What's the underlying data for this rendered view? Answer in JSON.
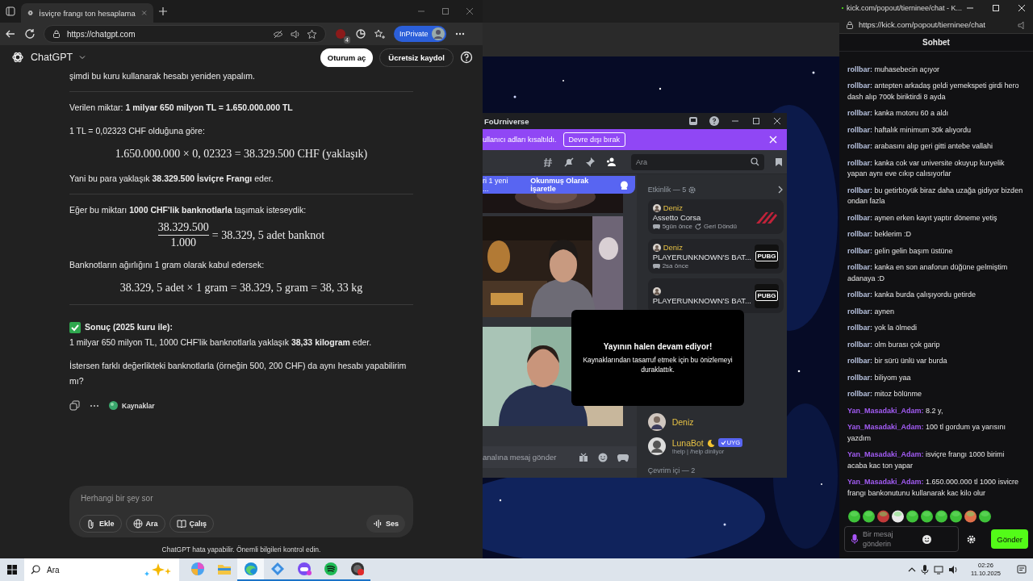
{
  "browser": {
    "tab_title": "İsviçre frangı ton hesaplama",
    "address": "https://chatgpt.com",
    "extension_badge": "4",
    "profile_label": "InPrivate"
  },
  "chatgpt": {
    "brand": "ChatGPT",
    "login_button": "Oturum aç",
    "signup_button": "Ücretsiz kaydol",
    "blocks": [
      {
        "kind": "paragraph",
        "text": "şimdi bu kuru kullanarak hesabı yeniden yapalım."
      },
      {
        "kind": "rule"
      },
      {
        "kind": "paragraph",
        "text": "Verilen miktar: **1 milyar 650 milyon TL = 1.650.000.000 TL**"
      },
      {
        "kind": "paragraph",
        "text": "1 TL = 0,02323 CHF olduğuna göre:"
      },
      {
        "kind": "formula",
        "text": "1.650.000.000 × 0, 02323 = 38.329.500 CHF (yaklaşık)"
      },
      {
        "kind": "paragraph",
        "text": "Yani bu para yaklaşık **38.329.500 İsviçre Frangı** eder."
      },
      {
        "kind": "rule"
      },
      {
        "kind": "paragraph",
        "text": "Eğer bu miktarı **1000 CHF'lik banknotlarla** taşımak isteseydik:"
      },
      {
        "kind": "fraction",
        "numerator": "38.329.500",
        "denominator": "1.000",
        "rest": "= 38.329, 5 adet banknot"
      },
      {
        "kind": "paragraph",
        "text": "Banknotların ağırlığını 1 gram olarak kabul edersek:"
      },
      {
        "kind": "formula",
        "text": "38.329, 5 adet × 1 gram = 38.329, 5 gram = 38, 33 kg"
      },
      {
        "kind": "rule"
      },
      {
        "kind": "heading",
        "text": "Sonuç (2025 kuru ile):"
      },
      {
        "kind": "paragraph",
        "text": "1 milyar 650 milyon TL, 1000 CHF'lik banknotlarla yaklaşık **38,33 kilogram** eder."
      },
      {
        "kind": "paragraph",
        "text": "İstersen farklı değerlikteki banknotlarla (örneğin 500, 200 CHF) da aynı hesabı yapabilirim mı?"
      }
    ],
    "sources_label": "Kaynaklar",
    "composer": {
      "placeholder": "Herhangi bir şey sor",
      "tools": [
        {
          "kind": "attach",
          "label": "Ekle"
        },
        {
          "kind": "search",
          "label": "Ara"
        },
        {
          "kind": "study",
          "label": "Çalış"
        }
      ],
      "voice": "Ses"
    },
    "disclaimer": "ChatGPT hata yapabilir. Önemli bilgileri kontrol edin."
  },
  "discord": {
    "title": "FoUrniverse",
    "banner": {
      "text": "ullanıcı adları kısaltıldı.",
      "button": "Devre dışı bırak"
    },
    "toolbar": [
      {
        "kind": "threads",
        "selected": false
      },
      {
        "kind": "mute",
        "selected": false
      },
      {
        "kind": "pin",
        "selected": false
      },
      {
        "kind": "members",
        "selected": true
      }
    ],
    "search_placeholder": "Ara",
    "unread_bar": {
      "text": "ri 1 yeni ...",
      "action": "Okunmuş Olarak İşaretle"
    },
    "message_placeholder": "analına mesaj gönder",
    "activity": {
      "title": "Etkinlik — 5",
      "cards": [
        {
          "user": "Deniz",
          "game": "Assetto Corsa",
          "time": "5gün önce",
          "status": "Geri Döndü",
          "kind": "assetto"
        },
        {
          "user": "Deniz",
          "game": "PLAYERUNKNOWN'S BAT...",
          "time": "2sa önce",
          "kind": "pubg",
          "art_text": "PUBG"
        },
        {
          "game": "PLAYERUNKNOWN'S BAT...",
          "kind": "pubg",
          "art_text": "PUBG"
        }
      ]
    },
    "notice": {
      "title": "Yayının halen devam ediyor!",
      "text": "Kaynaklarından tasarruf etmek için bu önizlemeyi duraklattık."
    },
    "members": [
      {
        "name": "Deniz",
        "bot": false
      },
      {
        "name": "LunaBot",
        "bot": true,
        "tag": "UYG",
        "status": "!help | /help dinliyor"
      }
    ],
    "online_header": "Çevrim içi — 2"
  },
  "kick": {
    "title": "kick.com/popout/tierninee/chat - K...",
    "address": "https://kick.com/popout/tierninee/chat",
    "header": "Sohbet",
    "messages": [
      {
        "user": "rollbar:",
        "color": "#b7c2de",
        "text": "muhasebecin açıyor"
      },
      {
        "user": "rollbar:",
        "color": "#b7c2de",
        "text": "antepten arkadaş geldi yemekspeti girdi hero dash alıp 700k biriktirdi 8 ayda"
      },
      {
        "user": "rollbar:",
        "color": "#b7c2de",
        "text": "kanka motoru 60 a aldı"
      },
      {
        "user": "rollbar:",
        "color": "#b7c2de",
        "text": "haftalık minimum 30k alıyordu"
      },
      {
        "user": "rollbar:",
        "color": "#b7c2de",
        "text": "arabasını alıp geri gitti antebe vallahi"
      },
      {
        "user": "rollbar:",
        "color": "#b7c2de",
        "text": "kanka cok var universite okuyup kuryelik yapan aynı eve cıkıp calısıyorlar"
      },
      {
        "user": "rollbar:",
        "color": "#b7c2de",
        "text": "bu getirbüyük biraz daha uzağa gidiyor bizden ondan fazla"
      },
      {
        "user": "rollbar:",
        "color": "#b7c2de",
        "text": "aynen erken kayıt yaptır döneme yetiş"
      },
      {
        "user": "rollbar:",
        "color": "#b7c2de",
        "text": "beklerim :D"
      },
      {
        "user": "rollbar:",
        "color": "#b7c2de",
        "text": "gelin gelin başım üstüne"
      },
      {
        "user": "rollbar:",
        "color": "#b7c2de",
        "text": "kanka en son anaforun düğüne gelmiştim adanaya :D"
      },
      {
        "user": "rollbar:",
        "color": "#b7c2de",
        "text": "kanka burda çalışıyordu getirde"
      },
      {
        "user": "rollbar:",
        "color": "#b7c2de",
        "text": "aynen"
      },
      {
        "user": "rollbar:",
        "color": "#b7c2de",
        "text": "yok la ölmedi"
      },
      {
        "user": "rollbar:",
        "color": "#b7c2de",
        "text": "olm burası çok garip"
      },
      {
        "user": "rollbar:",
        "color": "#b7c2de",
        "text": "bir sürü ünlü var burda"
      },
      {
        "user": "rollbar:",
        "color": "#b7c2de",
        "text": "biliyom yaa"
      },
      {
        "user": "rollbar:",
        "color": "#b7c2de",
        "text": "mitoz bölünme"
      },
      {
        "user": "Yan_Masadaki_Adam:",
        "color": "#a35cf5",
        "text": "8.2 y,"
      },
      {
        "user": "Yan_Masadaki_Adam:",
        "color": "#a35cf5",
        "text": "100 tl gordum ya yarısını yazdım"
      },
      {
        "user": "Yan_Masadaki_Adam:",
        "color": "#a35cf5",
        "text": "isviçre frangı 1000 birimi acaba kac ton yapar"
      },
      {
        "user": "Yan_Masadaki_Adam:",
        "color": "#a35cf5",
        "text": "1.650.000.000 tl 1000 isvicre frangı bankonutunu kullanarak kac kilo olur"
      }
    ],
    "input_placeholder": "Bir mesaj gönderin",
    "send_button": "Gönder"
  },
  "taskbar": {
    "search_placeholder": "Ara",
    "apps": [
      {
        "kind": "swirl",
        "selected": false,
        "running": false
      },
      {
        "kind": "folder",
        "selected": false,
        "running": false
      },
      {
        "kind": "browser",
        "selected": true,
        "running": true
      },
      {
        "kind": "cube",
        "selected": false,
        "running": true
      },
      {
        "kind": "controller",
        "selected": false,
        "running": true
      },
      {
        "kind": "music",
        "selected": false,
        "running": true
      },
      {
        "kind": "record",
        "selected": false,
        "running": true
      }
    ],
    "time": "02:26",
    "date": "11.10.2025"
  }
}
